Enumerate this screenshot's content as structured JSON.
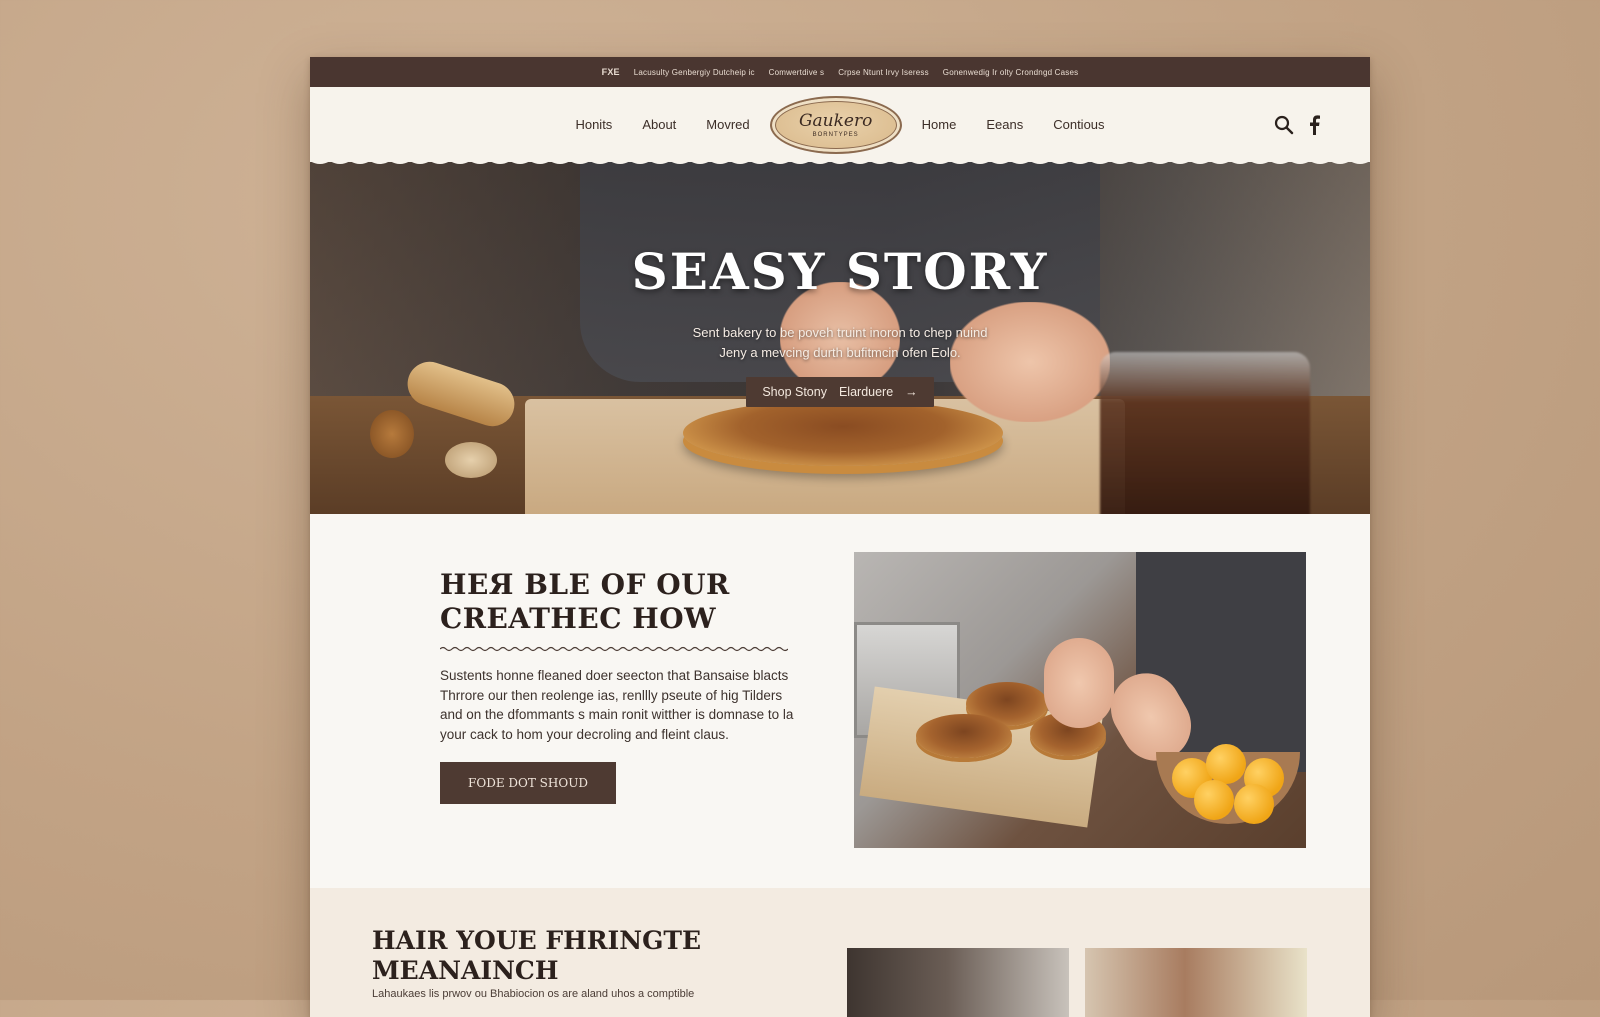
{
  "topbar": {
    "brand": "FXE",
    "items": [
      "Lacusulty Genbergiy Dutcheip ic",
      "Comwertdive s",
      "Crpse Ntunt Irvy Iseress",
      "Gonenwedig Ir olty Crondngd Cases"
    ]
  },
  "nav": {
    "left": [
      "Honits",
      "About",
      "Movred"
    ],
    "right": [
      "Home",
      "Eeans",
      "Contious"
    ]
  },
  "logo": {
    "name": "Gaukero",
    "sub": "BORNTYPES"
  },
  "header_icons": [
    "search-icon",
    "facebook-icon"
  ],
  "hero": {
    "title": "SEASY STORY",
    "subtitle_line1": "Sent bakery to be poveh truint inoron to chep nuind",
    "subtitle_line2": "Jeny a mevcing durth bufitmcin ofen Eolo.",
    "button_label": "Shop Stony",
    "button_label2": "Elarduere",
    "button_arrow": "→"
  },
  "story": {
    "title_line1": "HEЯ BLE OF OUR",
    "title_line2": "CREATHEC HOW",
    "body": "Sustents honne fleaned doer seecton that Bansaise blacts Thrrore our then reolenge ias, renllly pseute of hig Tilders and on the dfommants s main ronit witther is domnase to la your cack to hom your decroling and fleint claus.",
    "button_label": "FODE DOT SHOUD"
  },
  "bottom": {
    "title_line1": "HAIR YOUE FHRINGTE",
    "title_line2": "MEANAINCH",
    "text": "Lahaukaes lis prwov ou Bhabiocion os are aland uhos a comptible"
  },
  "colors": {
    "page_bg": "#c2a385",
    "dark_brown": "#4a3630",
    "button_brown": "#4e3a32",
    "cream": "#f8f5f0"
  }
}
